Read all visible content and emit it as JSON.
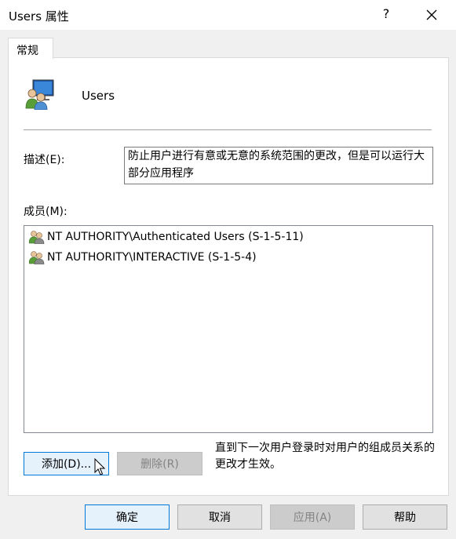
{
  "window": {
    "title": "Users 属性",
    "help_label": "?",
    "close_icon": "close-icon"
  },
  "tabs": [
    {
      "label": "常规",
      "selected": true
    }
  ],
  "group": {
    "icon": "user-group-icon",
    "name": "Users"
  },
  "description": {
    "label": "描述(E):",
    "value": "防止用户进行有意或无意的系统范围的更改，但是可以运行大部分应用程序"
  },
  "members": {
    "label": "成员(M):",
    "items": [
      {
        "icon": "user-group-icon",
        "name": "NT AUTHORITY\\Authenticated Users (S-1-5-11)"
      },
      {
        "icon": "user-group-icon",
        "name": "NT AUTHORITY\\INTERACTIVE (S-1-5-4)"
      }
    ]
  },
  "actions": {
    "add_label": "添加(D)...",
    "remove_label": "删除(R)",
    "note": "直到下一次用户登录时对用户的组成员关系的更改才生效。"
  },
  "footer": {
    "ok_label": "确定",
    "cancel_label": "取消",
    "apply_label": "应用(A)",
    "help_label": "帮助"
  },
  "colors": {
    "accent": "#0078d7",
    "window_bg": "#f0f0f0",
    "panel_bg": "#ffffff"
  }
}
